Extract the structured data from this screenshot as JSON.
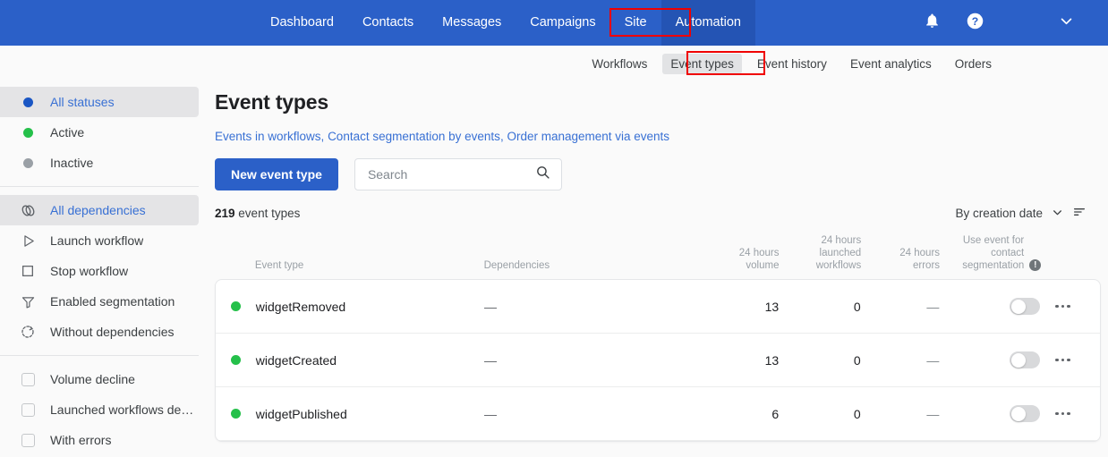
{
  "topbar": {
    "nav": [
      {
        "label": "Dashboard",
        "active": false
      },
      {
        "label": "Contacts",
        "active": false
      },
      {
        "label": "Messages",
        "active": false
      },
      {
        "label": "Campaigns",
        "active": false
      },
      {
        "label": "Site",
        "active": false
      },
      {
        "label": "Automation",
        "active": true
      }
    ],
    "icons": {
      "notifications": "bell-icon",
      "help": "help-circle-icon",
      "account_menu": "chevron-down-icon"
    },
    "bg_color": "#2b60c8",
    "active_bg_color": "#2454b4",
    "highlight_color": "#f00000"
  },
  "subnav": {
    "items": [
      {
        "label": "Workflows",
        "selected": false
      },
      {
        "label": "Event types",
        "selected": true
      },
      {
        "label": "Event history",
        "selected": false
      },
      {
        "label": "Event analytics",
        "selected": false
      },
      {
        "label": "Orders",
        "selected": false
      }
    ]
  },
  "sidebar": {
    "groups": [
      {
        "items": [
          {
            "label": "All statuses",
            "icon": "status-dot-blue",
            "highlight": true
          },
          {
            "label": "Active",
            "icon": "status-dot-green",
            "highlight": false
          },
          {
            "label": "Inactive",
            "icon": "status-dot-grey",
            "highlight": false
          }
        ]
      },
      {
        "items": [
          {
            "label": "All dependencies",
            "icon": "link-rings-icon",
            "highlight": true
          },
          {
            "label": "Launch workflow",
            "icon": "play-triangle-icon",
            "highlight": false
          },
          {
            "label": "Stop workflow",
            "icon": "stop-square-icon",
            "highlight": false
          },
          {
            "label": "Enabled segmentation",
            "icon": "funnel-icon",
            "highlight": false
          },
          {
            "label": "Without dependencies",
            "icon": "dashed-refresh-icon",
            "highlight": false
          }
        ]
      },
      {
        "items": [
          {
            "label": "Volume decline",
            "icon": "checkbox-icon",
            "highlight": false
          },
          {
            "label": "Launched workflows de…",
            "icon": "checkbox-icon",
            "highlight": false
          },
          {
            "label": "With errors",
            "icon": "checkbox-icon",
            "highlight": false
          }
        ]
      }
    ]
  },
  "main": {
    "title": "Event types",
    "links": [
      {
        "label": "Events in workflows"
      },
      {
        "label": "Contact segmentation by events"
      },
      {
        "label": "Order management via events"
      }
    ],
    "links_separator": ", ",
    "new_button_label": "New event type",
    "search": {
      "placeholder": "Search",
      "value": "",
      "icon": "search-icon"
    },
    "count": {
      "number": "219",
      "label": "event types"
    },
    "sort": {
      "label": "By creation date",
      "chevron_icon": "chevron-down-icon",
      "order_icon": "sort-lines-icon"
    },
    "table": {
      "columns": [
        {
          "key": "status",
          "label": ""
        },
        {
          "key": "event_type",
          "label": "Event type"
        },
        {
          "key": "dependencies",
          "label": "Dependencies"
        },
        {
          "key": "volume_24h",
          "label": "24 hours\nvolume"
        },
        {
          "key": "launched_workflows_24h",
          "label": "24 hours\nlaunched\nworkflows"
        },
        {
          "key": "errors_24h",
          "label": "24 hours\nerrors"
        },
        {
          "key": "segmentation",
          "label": "Use event for\ncontact\nsegmentation",
          "info_icon": "info-icon"
        },
        {
          "key": "menu",
          "label": ""
        }
      ],
      "rows": [
        {
          "status": "active",
          "event_type": "widgetRemoved",
          "dependencies": "—",
          "volume_24h": "13",
          "launched_workflows_24h": "0",
          "errors_24h": "—",
          "segmentation_on": false,
          "menu_icon": "kebab-menu-icon"
        },
        {
          "status": "active",
          "event_type": "widgetCreated",
          "dependencies": "—",
          "volume_24h": "13",
          "launched_workflows_24h": "0",
          "errors_24h": "—",
          "segmentation_on": false,
          "menu_icon": "kebab-menu-icon"
        },
        {
          "status": "active",
          "event_type": "widgetPublished",
          "dependencies": "—",
          "volume_24h": "6",
          "launched_workflows_24h": "0",
          "errors_24h": "—",
          "segmentation_on": false,
          "menu_icon": "kebab-menu-icon"
        }
      ]
    }
  },
  "colors": {
    "accent_blue": "#2b60c8",
    "link_blue": "#3870d4",
    "status_green": "#25c04a",
    "status_grey": "#9aa0a6",
    "highlight_red": "#f00000"
  }
}
